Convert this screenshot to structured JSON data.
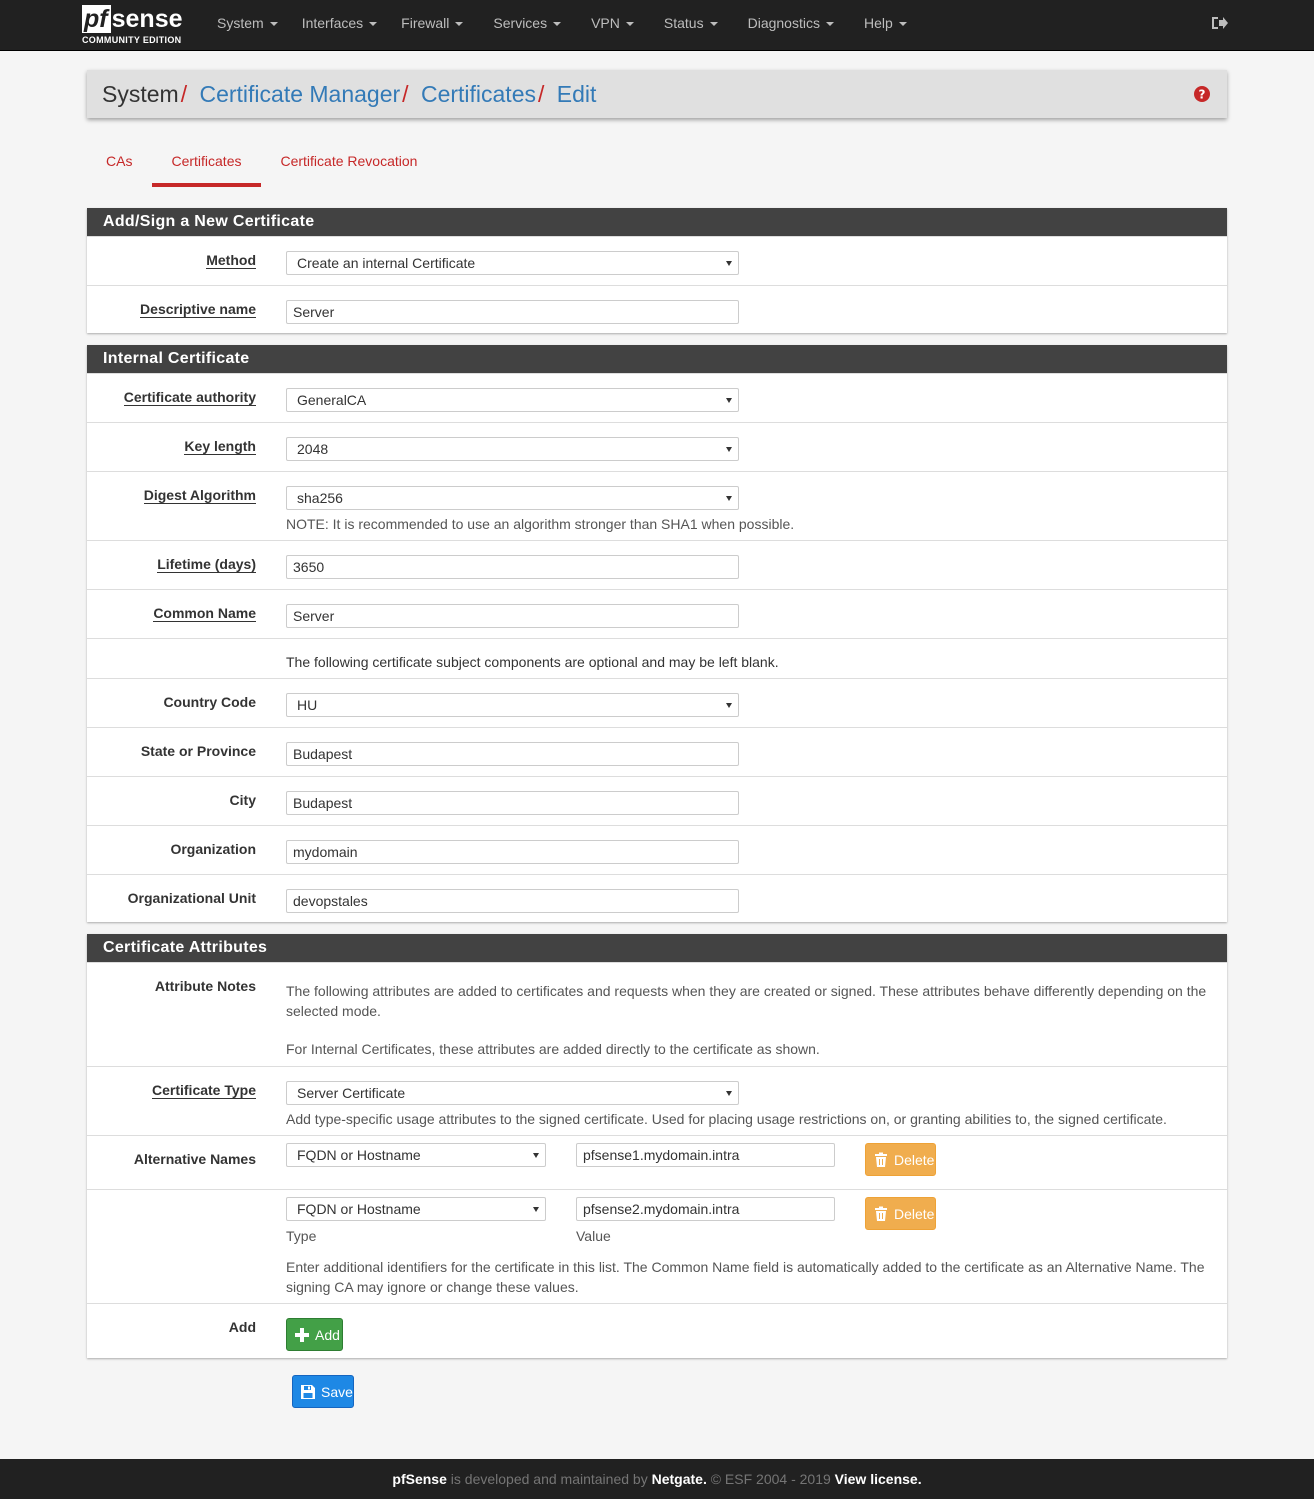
{
  "brand": {
    "logo_pf": "pf",
    "logo_sense": "sense",
    "edition": "COMMUNITY EDITION"
  },
  "nav": [
    {
      "label": "System"
    },
    {
      "label": "Interfaces"
    },
    {
      "label": "Firewall"
    },
    {
      "label": "Services"
    },
    {
      "label": "VPN"
    },
    {
      "label": "Status"
    },
    {
      "label": "Diagnostics"
    },
    {
      "label": "Help"
    }
  ],
  "breadcrumb": {
    "root": "System",
    "sep": "/",
    "links": [
      "Certificate Manager",
      "Certificates",
      "Edit"
    ]
  },
  "tabs": [
    {
      "label": "CAs",
      "active": false
    },
    {
      "label": "Certificates",
      "active": true
    },
    {
      "label": "Certificate Revocation",
      "active": false
    }
  ],
  "panel1": {
    "heading": "Add/Sign a New Certificate",
    "method_label": "Method",
    "method_value": "Create an internal Certificate",
    "descname_label": "Descriptive name",
    "descname_value": "Server"
  },
  "panel2": {
    "heading": "Internal Certificate",
    "ca_label": "Certificate authority",
    "ca_value": "GeneralCA",
    "keylen_label": "Key length",
    "keylen_value": "2048",
    "digest_label": "Digest Algorithm",
    "digest_value": "sha256",
    "digest_note": "NOTE: It is recommended to use an algorithm stronger than SHA1 when possible.",
    "lifetime_label": "Lifetime (days)",
    "lifetime_value": "3650",
    "cn_label": "Common Name",
    "cn_value": "Server",
    "optional_note": "The following certificate subject components are optional and may be left blank.",
    "country_label": "Country Code",
    "country_value": "HU",
    "state_label": "State or Province",
    "state_value": "Budapest",
    "city_label": "City",
    "city_value": "Budapest",
    "org_label": "Organization",
    "org_value": "mydomain",
    "ou_label": "Organizational Unit",
    "ou_value": "devopstales"
  },
  "panel3": {
    "heading": "Certificate Attributes",
    "notes_label": "Attribute Notes",
    "notes_text1": "The following attributes are added to certificates and requests when they are created or signed. These attributes behave differently depending on the selected mode.",
    "notes_text2": "For Internal Certificates, these attributes are added directly to the certificate as shown.",
    "certtype_label": "Certificate Type",
    "certtype_value": "Server Certificate",
    "certtype_help": "Add type-specific usage attributes to the signed certificate. Used for placing usage restrictions on, or granting abilities to, the signed certificate.",
    "altnames_label": "Alternative Names",
    "altnames": [
      {
        "type": "FQDN or Hostname",
        "value": "pfsense1.mydomain.intra"
      },
      {
        "type": "FQDN or Hostname",
        "value": "pfsense2.mydomain.intra"
      }
    ],
    "type_caption": "Type",
    "value_caption": "Value",
    "delete_label": "Delete",
    "altnames_help": "Enter additional identifiers for the certificate in this list. The Common Name field is automatically added to the certificate as an Alternative Name. The signing CA may ignore or change these values.",
    "add_row_label": "Add",
    "add_button": "Add"
  },
  "save_button": "Save",
  "footer": {
    "brand": "pfSense",
    "text1": " is developed and maintained by ",
    "company": "Netgate.",
    "text2": " © ESF 2004 - 2019 ",
    "license": "View license."
  },
  "colors": {
    "accent": "#c62828",
    "link": "#337ab7",
    "navbar": "#212121",
    "heading": "#424242"
  }
}
